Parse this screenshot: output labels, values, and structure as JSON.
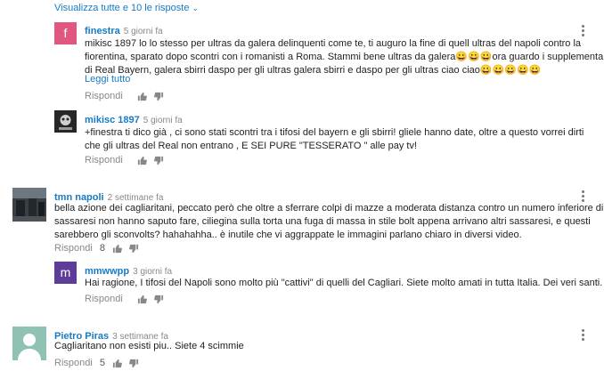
{
  "view_replies": "Visualizza tutte e 10 le risposte",
  "comments": [
    {
      "author": "finestra",
      "time": "5 giorni fa",
      "avatar_letter": "f",
      "avatar_color": "#e05880",
      "lines": [
        "mikisc 1897 lo lo stesso per ultras da galera delinquenti come te, ti auguro la fine di quell ultras del napoli  contro la",
        "fiorentina, sparato dopo scontri con i romanisti a Roma. Stammi bene ultras da galera😀😀😀ora guardo i supplementari",
        "di Real Bayern,  galera sbirri  daspo  per gli ultras galera sbirri e daspo per gli ultras ciao ciao😀😀😀😀😀"
      ],
      "read_more": "Leggi tutto",
      "reply": "Rispondi",
      "likes": ""
    },
    {
      "author": "mikisc 1897",
      "time": "5 giorni fa",
      "lines": [
        "+finestra  ti dico già , ci sono stati scontri tra i tifosi del bayern e gli sbirri!  gliele hanno date, oltre  a questo vorrei dirti",
        "che gli ultras del Real non entrano , E SEI PURE \"TESSERATO \" alle pay  tv!"
      ],
      "reply": "Rispondi",
      "likes": ""
    },
    {
      "author": "tmn napoli",
      "time": "2 settimane fa",
      "lines": [
        "bella azione dei cagliaritani, peccato però che oltre a sferrare colpi di mazze a moderata distanza contro un numero inferiore di",
        "sassaresi non hanno saputo fare, ciliegina sulla torta una fuga di massa in stile bolt appena arrivano altri sassaresi, e questi",
        "sarebbero gli sconvolts? hahahahha.. è inutile che vi aggrappate le immagini parlano chiaro in diversi video."
      ],
      "reply": "Rispondi",
      "likes": "8"
    },
    {
      "author": "mmwwpp",
      "time": "3 giorni fa",
      "avatar_letter": "m",
      "avatar_color": "#5e3c99",
      "lines": [
        "Hai ragione, I tifosi del Napoli sono molto più \"cattivi\" di quelli del Cagliari. Siete molto amati in tutta Italia. Dei veri santi."
      ],
      "reply": "Rispondi",
      "likes": ""
    },
    {
      "author": "Pietro Piras",
      "time": "3 settimane fa",
      "lines": [
        "Cagliaritano non esisti piu.. Siete 4 scimmie"
      ],
      "reply": "Rispondi",
      "likes": "5"
    }
  ]
}
